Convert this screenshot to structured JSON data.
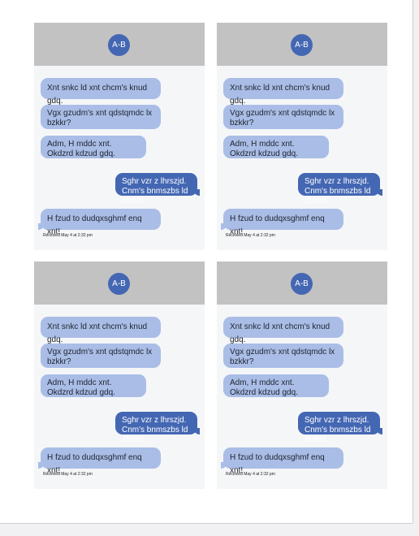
{
  "cards": [
    {
      "avatar": "A-B",
      "messages": [
        "Xnt snkc ld xnt chcm's knud gdq.",
        "Vgx gzudm's xnt qdstqmdc lx bzkkr?",
        "Adm,  H mddc xnt. Okdzrd kdzud gdq.",
        "Sghr vzr z lhrszjd. Cnm's bnmszbs ld zfzhm.",
        "H fzud to dudqxsghmf enq xnt!"
      ],
      "received": "Received May 4 at 2:32 pm"
    },
    {
      "avatar": "A-B",
      "messages": [
        "Xnt snkc ld xnt chcm's knud gdq.",
        "Vgx gzudm's xnt qdstqmdc lx bzkkr?",
        "Adm,  H mddc xnt. Okdzrd kdzud gdq.",
        "Sghr vzr z lhrszjd. Cnm's bnmszbs ld zfzhm.",
        "H fzud to dudqxsghmf enq xnt!"
      ],
      "received": "Received May 4 at 2:32 pm"
    },
    {
      "avatar": "A-B",
      "messages": [
        "Xnt snkc ld xnt chcm's knud gdq.",
        "Vgx gzudm's xnt qdstqmdc lx bzkkr?",
        "Adm,  H mddc xnt. Okdzrd kdzud gdq.",
        "Sghr vzr z lhrszjd. Cnm's bnmszbs ld zfzhm.",
        "H fzud to dudqxsghmf enq xnt!"
      ],
      "received": "Received May 4 at 2:32 pm"
    },
    {
      "avatar": "A-B",
      "messages": [
        "Xnt snkc ld xnt chcm's knud gdq.",
        "Vgx gzudm's xnt qdstqmdc lx bzkkr?",
        "Adm,  H mddc xnt. Okdzrd kdzud gdq.",
        "Sghr vzr z lhrszjd. Cnm's bnmszbs ld zfzhm.",
        "H fzud to dudqxsghmf enq xnt!"
      ],
      "received": "Received May 4 at 2:32 pm"
    }
  ],
  "colors": {
    "header": "#c2c2c2",
    "avatar": "#4467b3",
    "incoming_bubble": "#a9bde6",
    "outgoing_bubble": "#4467b3",
    "card_background": "#f5f6f8"
  }
}
